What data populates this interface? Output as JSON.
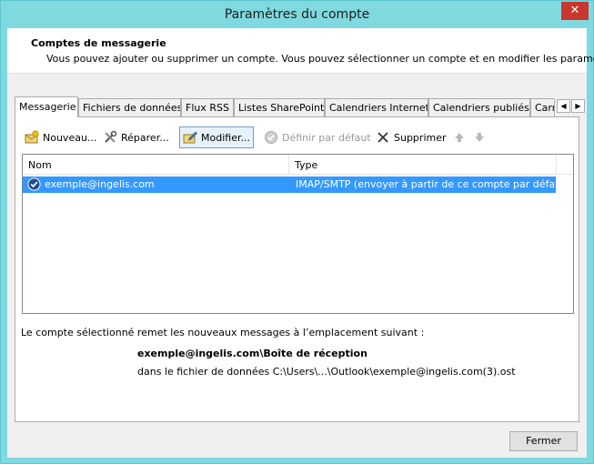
{
  "window": {
    "title": "Paramètres du compte",
    "close_glyph": "✕"
  },
  "header": {
    "title": "Comptes de messagerie",
    "description": "Vous pouvez ajouter ou supprimer un compte. Vous pouvez sélectionner un compte et en modifier les paramètres."
  },
  "tabs": [
    {
      "label": "Messagerie"
    },
    {
      "label": "Fichiers de données"
    },
    {
      "label": "Flux RSS"
    },
    {
      "label": "Listes SharePoint"
    },
    {
      "label": "Calendriers Internet"
    },
    {
      "label": "Calendriers publiés"
    },
    {
      "label": "Carnets"
    }
  ],
  "toolbar": {
    "new_label": "Nouveau...",
    "repair_label": "Réparer...",
    "modify_label": "Modifier...",
    "default_label": "Définir par défaut",
    "delete_label": "Supprimer"
  },
  "list": {
    "columns": [
      "Nom",
      "Type"
    ],
    "rows": [
      {
        "name": "exemple@ingelis.com",
        "type": "IMAP/SMTP (envoyer à partir de ce compte par défaut)"
      }
    ]
  },
  "delivery": {
    "caption": "Le compte sélectionné remet les nouveaux messages à l’emplacement suivant :",
    "location": "exemple@ingelis.com\\Boîte de réception",
    "datafile": "dans le fichier de données C:\\Users\\...\\Outlook\\exemple@ingelis.com(3).ost"
  },
  "footer": {
    "close_label": "Fermer"
  },
  "colors": {
    "titlebar": "#7fd9df",
    "selection": "#3399ff",
    "close": "#c7372f"
  }
}
